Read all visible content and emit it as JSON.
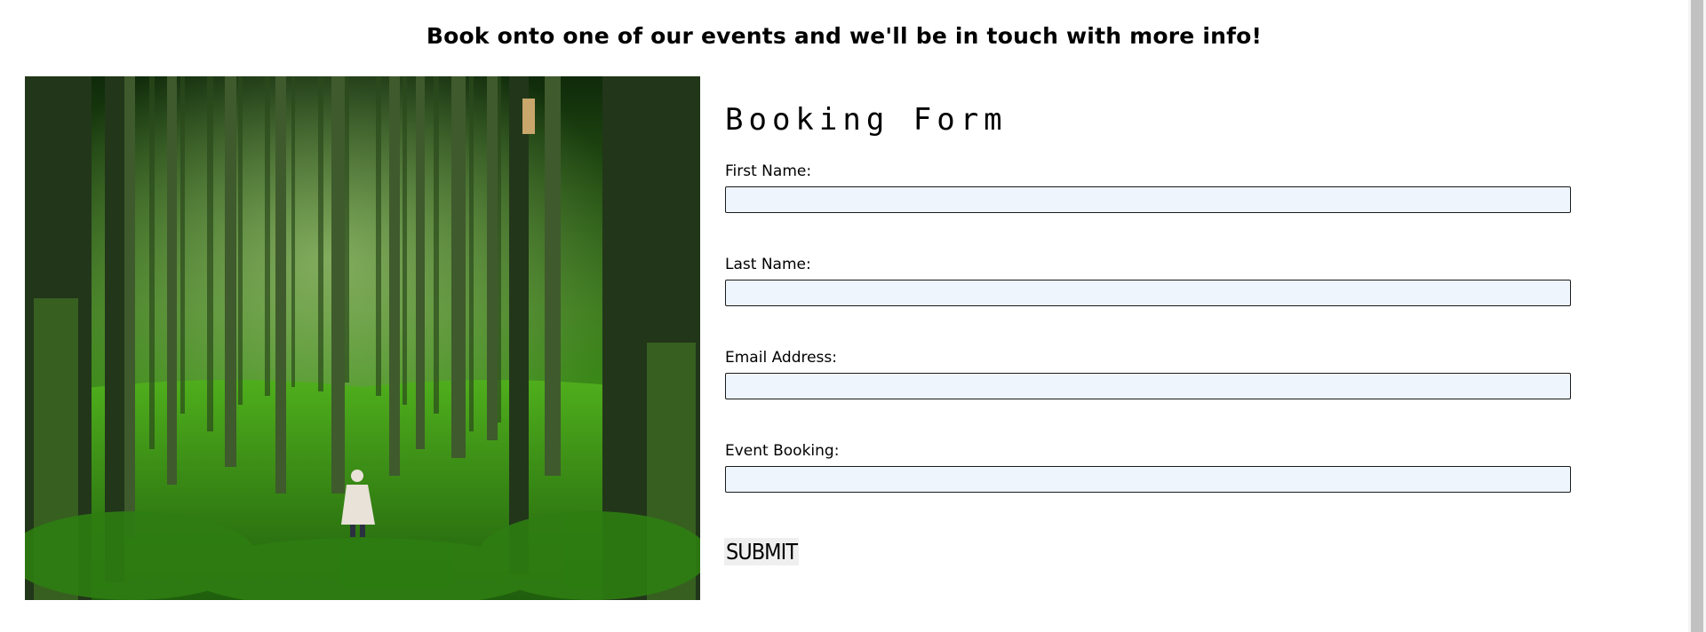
{
  "header": {
    "title": "Book onto one of our events and we'll be in touch with more info!"
  },
  "form": {
    "title": "Booking Form",
    "fields": [
      {
        "label": "First Name:",
        "value": "",
        "placeholder": ""
      },
      {
        "label": "Last Name:",
        "value": "",
        "placeholder": ""
      },
      {
        "label": "Email Address:",
        "value": "",
        "placeholder": ""
      },
      {
        "label": "Event Booking:",
        "value": "",
        "placeholder": ""
      }
    ],
    "submit_label": "SUBMIT"
  },
  "colors": {
    "input_background": "#eef5fd",
    "forest_green": "#2f8a12"
  },
  "icons": {
    "hero_image": "forest-photo"
  }
}
